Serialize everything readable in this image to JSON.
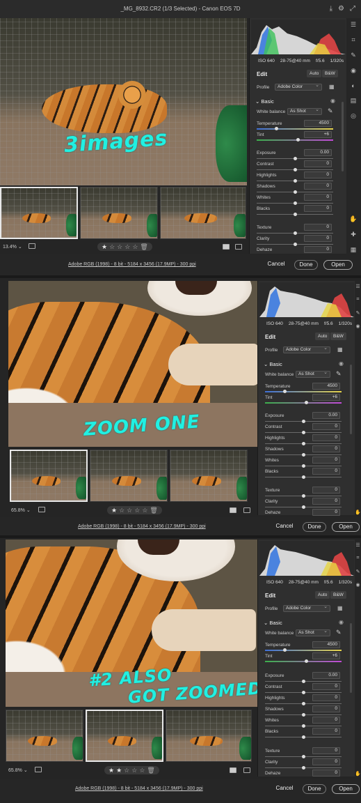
{
  "window": {
    "title": "_MG_8932.CR2 (1/3 Selected)  -  Canon EOS 7D"
  },
  "camera": {
    "iso": "ISO 640",
    "lens": "28-75@40 mm",
    "aperture": "f/5.6",
    "shutter": "1/320s"
  },
  "edit": {
    "title": "Edit",
    "auto_label": "Auto",
    "bw_label": "B&W",
    "profile_label": "Profile",
    "profile_value": "Adobe Color",
    "section_basic": "Basic",
    "white_balance_label": "White balance",
    "white_balance_value": "As Shot",
    "sliders": [
      {
        "label": "Temperature",
        "value": "4500"
      },
      {
        "label": "Tint",
        "value": "+6"
      },
      {
        "label": "Exposure",
        "value": "0.00"
      },
      {
        "label": "Contrast",
        "value": "0"
      },
      {
        "label": "Highlights",
        "value": "0"
      },
      {
        "label": "Shadows",
        "value": "0"
      },
      {
        "label": "Whites",
        "value": "0"
      },
      {
        "label": "Blacks",
        "value": "0"
      },
      {
        "label": "Texture",
        "value": "0"
      },
      {
        "label": "Clarity",
        "value": "0"
      },
      {
        "label": "Dehaze",
        "value": "0"
      }
    ]
  },
  "footer": {
    "info": "Adobe RGB (1998) - 8 bit - 5184 x 3456 (17.9MP) - 300 ppi",
    "cancel": "Cancel",
    "done": "Done",
    "open": "Open"
  },
  "panels": [
    {
      "zoom": "13.4%",
      "annotation": "3images",
      "rating_stars": 1,
      "selected_thumb": 0
    },
    {
      "zoom": "65.8%",
      "annotation": "ZOOM ONE",
      "rating_stars": 1,
      "selected_thumb": 0
    },
    {
      "zoom": "65.8%",
      "annotation": "#2 ALSO GOT ZOOMED",
      "annotation_line1": "#2 ALSO",
      "annotation_line2": "GOT ZOOMED",
      "rating_stars": 2,
      "selected_thumb": 1
    }
  ],
  "icons": {
    "chevron": "chevron-down-icon",
    "eyedropper": "eyedropper-icon",
    "eye": "eye-icon",
    "grid": "grid-icon",
    "hand": "hand-icon",
    "trash": "trash-icon"
  }
}
